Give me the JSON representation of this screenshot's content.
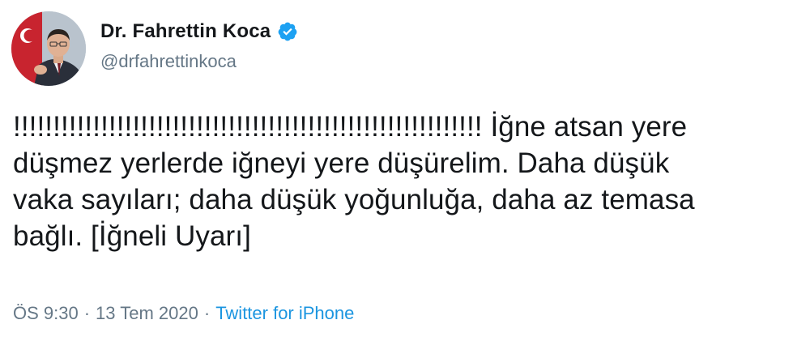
{
  "author": {
    "display_name": "Dr. Fahrettin Koca",
    "handle": "@drfahrettinkoca",
    "verified": true
  },
  "tweet": {
    "text": "!!!!!!!!!!!!!!!!!!!!!!!!!!!!!!!!!!!!!!!!!!!!!!!!!!!!!!!!!!! İğne atsan yere\ndüşmez yerlerde iğneyi yere düşürelim. Daha düşük\nvaka sayıları; daha düşük yoğunluğa, daha az temasa\nbağlı. [İğneli Uyarı]"
  },
  "meta": {
    "time": "ÖS 9:30",
    "separator_1": "·",
    "date": "13 Tem 2020",
    "separator_2": "·",
    "source": "Twitter for iPhone"
  },
  "colors": {
    "text": "#14171a",
    "secondary": "#657786",
    "link": "#1b95e0",
    "verified": "#1da1f2"
  },
  "icons": {
    "verified": "verified-badge-icon",
    "avatar": "profile-photo"
  }
}
